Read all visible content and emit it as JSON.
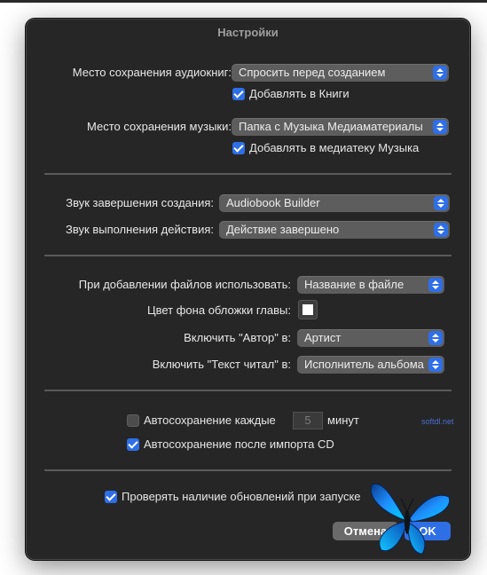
{
  "window": {
    "title": "Настройки"
  },
  "audiobooks": {
    "save_label": "Место сохранения аудиокниг:",
    "save_value": "Спросить перед созданием",
    "add_checkbox": "Добавлять в Книги",
    "add_checked": true
  },
  "music": {
    "save_label": "Место сохранения музыки:",
    "save_value": "Папка с Музыка Медиаматериалы",
    "add_checkbox": "Добавлять в медиатеку Музыка",
    "add_checked": true
  },
  "sounds": {
    "finish_label": "Звук завершения создания:",
    "finish_value": "Audiobook Builder",
    "action_label": "Звук выполнения действия:",
    "action_value": "Действие завершено"
  },
  "files": {
    "use_label": "При добавлении файлов использовать:",
    "use_value": "Название в файле",
    "chapter_color_label": "Цвет фона обложки главы:",
    "chapter_color": "#ffffff",
    "author_label": "Включить \"Автор\" в:",
    "author_value": "Артист",
    "narrator_label": "Включить \"Текст читал\" в:",
    "narrator_value": "Исполнитель альбома"
  },
  "autosave": {
    "every_label": "Автосохранение каждые",
    "every_checked": false,
    "minutes_value": "5",
    "minutes_unit": "минут",
    "after_cd_label": "Автосохранение после импорта CD",
    "after_cd_checked": true
  },
  "updates": {
    "check_label": "Проверять наличие обновлений при запуске",
    "check_checked": true
  },
  "buttons": {
    "cancel": "Отмена",
    "ok": "OK"
  },
  "watermark": "softdl.net",
  "colors": {
    "accent": "#2f6fe6",
    "panel": "#262626",
    "popup": "#5d5d5d"
  },
  "icons": {
    "decoration": "butterfly-icon"
  }
}
